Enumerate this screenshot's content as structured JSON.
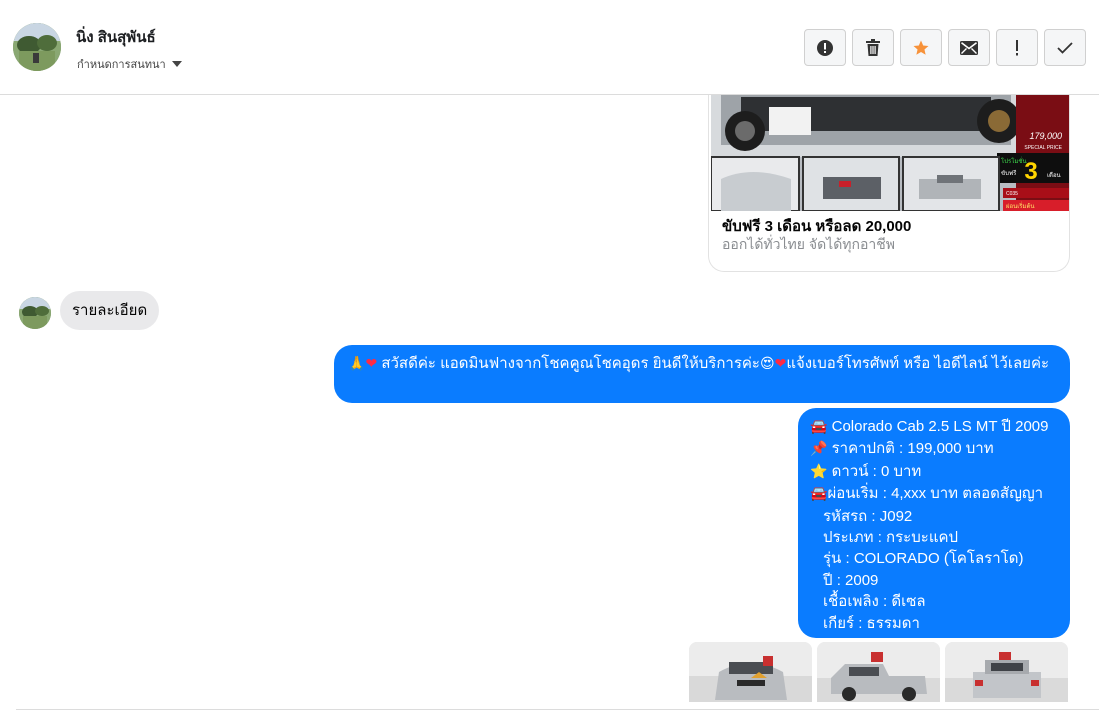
{
  "contact": {
    "name": "นิ่ง สินสุพันธ์",
    "label_menu": "กำหนดการสนทนา"
  },
  "actions": [
    {
      "name": "report-button",
      "icon": "alert-circle-icon"
    },
    {
      "name": "delete-button",
      "icon": "trash-icon"
    },
    {
      "name": "star-button",
      "icon": "star-icon"
    },
    {
      "name": "mail-button",
      "icon": "mail-icon"
    },
    {
      "name": "important-button",
      "icon": "exclamation-icon"
    },
    {
      "name": "done-button",
      "icon": "check-icon"
    }
  ],
  "colors": {
    "outgoing_bubble": "#0a7cff",
    "incoming_bubble": "#e9e9eb",
    "star": "#f7923a"
  },
  "link_card": {
    "title": "ขับฟรี 3 เดือน หรือลด 20,000",
    "subtitle": "ออกได้ทั่วไทย จัดได้ทุกอาชีพ",
    "image_price": "179,000",
    "image_special": "SPECIAL PRICE",
    "image_months": "3",
    "image_promo_top": "โปรโมชั่น",
    "image_promo_left": "ขับฟรี",
    "image_promo_right": "เดือน",
    "image_code": "C035",
    "image_tag": "ผ่อนเริ่มต้น"
  },
  "messages": {
    "incoming_1": "รายละเอียด",
    "greeting_emoji_1": "🙏",
    "greeting_heart_1": "❤",
    "greeting_text_1": " สวัสดีค่ะ แอดมินฟางจากโชคคูณโชคอุดร ยินดีให้บริการค่ะ",
    "greeting_emoji_2": "😍",
    "greeting_heart_2": "❤",
    "greeting_text_2": "แจ้งเบอร์โทรศัพท์ หรือ ไอดีไลน์  ไว้เลยค่ะ",
    "details": {
      "model_icon": "🚘",
      "model": " Colorado Cab 2.5 LS MT ปี 2009",
      "price_icon": "📌",
      "price": " ราคาปกติ : 199,000 บาท",
      "down_icon": "⭐",
      "down": " ดาวน์ : 0 บาท",
      "installment_icon": "🚘",
      "installment": "ผ่อนเริ่ม : 4,xxx บาท ตลอดสัญญา",
      "code": "รหัสรถ : J092",
      "type": "ประเภท : กระบะแคป",
      "series": "รุ่น : COLORADO (โคโลราโด)",
      "year": "ปี : 2009",
      "fuel": "เชื้อเพลิง : ดีเซล",
      "gear": "เกียร์ : ธรรมดา"
    }
  }
}
